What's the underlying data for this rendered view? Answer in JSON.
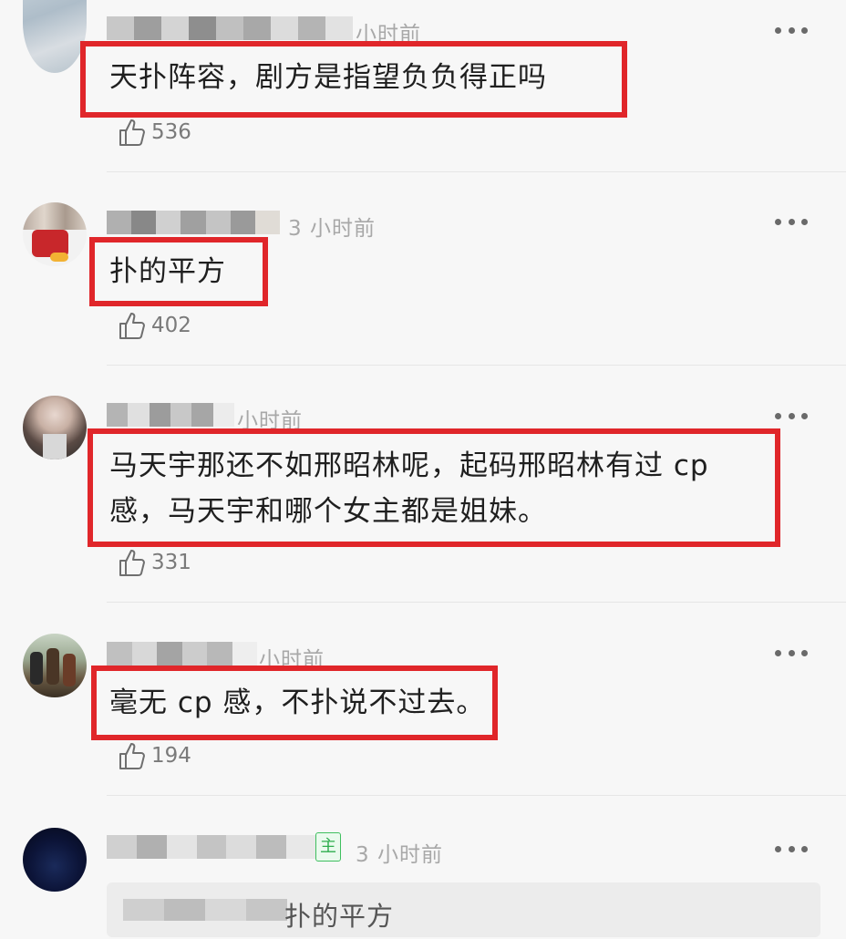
{
  "comments": [
    {
      "time": "小时前",
      "content": "天扑阵容，剧方是指望负负得正吗",
      "likes": "536"
    },
    {
      "time": "3 小时前",
      "content": "扑的平方",
      "likes": "402"
    },
    {
      "time": "小时前",
      "content_line1": "马天宇那还不如邢昭林呢，起码邢昭林有过 cp",
      "content_line2": "感，马天宇和哪个女主都是姐妹。",
      "likes": "331"
    },
    {
      "time": "小时前",
      "content": "毫无 cp 感，不扑说不过去。",
      "likes": "194"
    },
    {
      "time": "3 小时前",
      "badge": "主",
      "reply_preview": "扑的平方"
    }
  ],
  "colors": {
    "highlight": "#e0262a",
    "badge": "#2fae4f",
    "background": "#f7f7f7"
  },
  "icons": {
    "like": "thumbs-up-icon",
    "more": "more-dots-icon"
  }
}
